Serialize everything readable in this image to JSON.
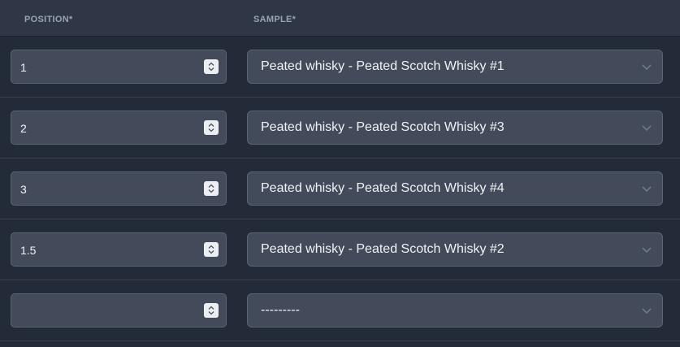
{
  "header": {
    "position_label": "POSITION*",
    "sample_label": "SAMPLE*"
  },
  "rows": [
    {
      "position": "1",
      "sample": "Peated whisky - Peated Scotch Whisky #1"
    },
    {
      "position": "2",
      "sample": "Peated whisky - Peated Scotch Whisky #3"
    },
    {
      "position": "3",
      "sample": "Peated whisky - Peated Scotch Whisky #4"
    },
    {
      "position": "1.5",
      "sample": "Peated whisky - Peated Scotch Whisky #2"
    },
    {
      "position": "",
      "sample": "---------"
    }
  ],
  "icons": {
    "stepper": "stepper-icon",
    "dropdown": "chevron-down-icon"
  },
  "colors": {
    "background": "#232a38",
    "header_background": "#2f3746",
    "field_background": "#434b5b",
    "field_border": "#5b6476"
  }
}
